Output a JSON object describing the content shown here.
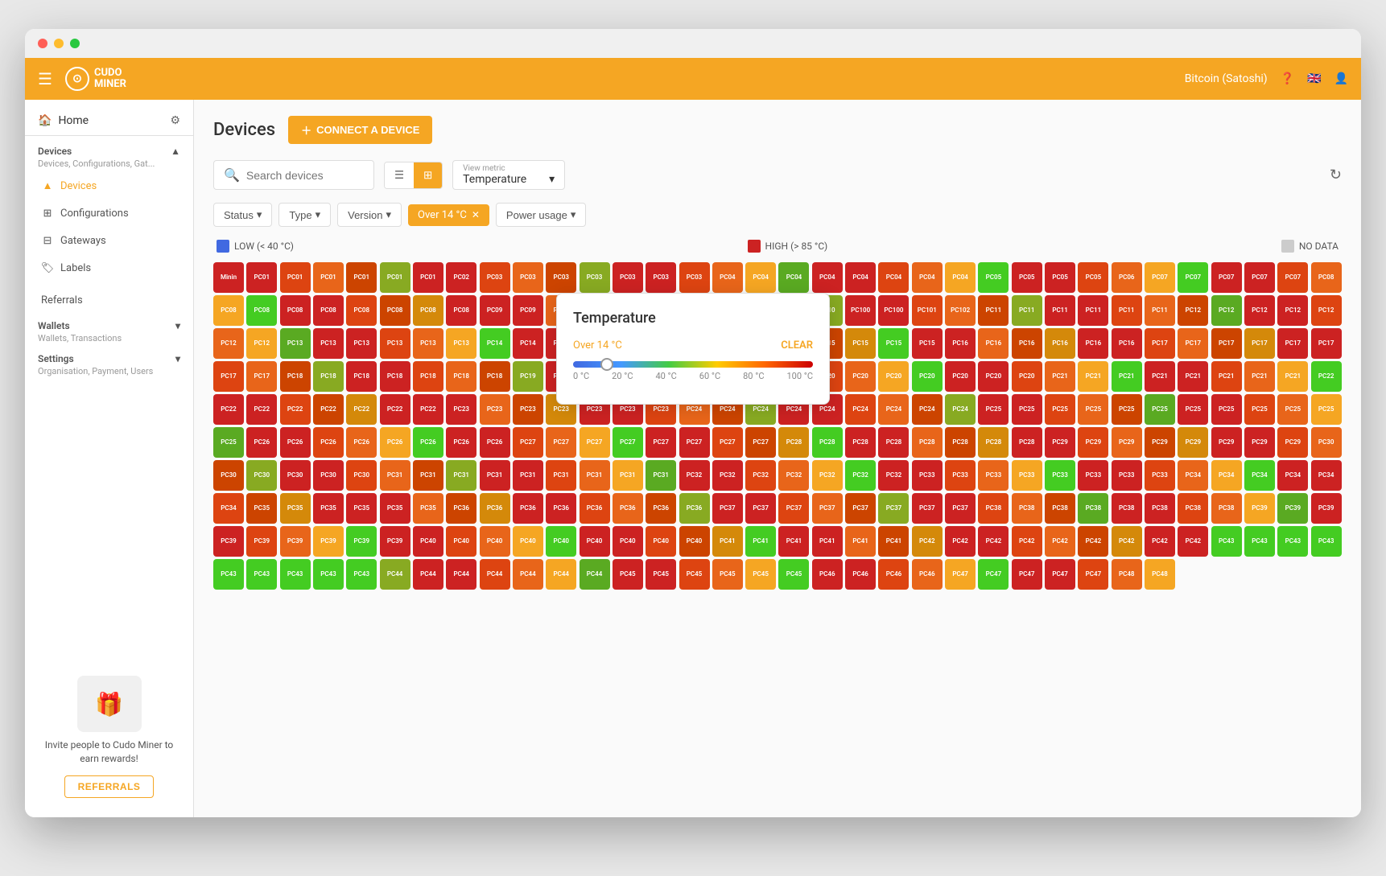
{
  "window": {
    "title": "Cudo Miner"
  },
  "navbar": {
    "logo_text": "CUDO\nMINER",
    "currency": "Bitcoin (Satoshi)",
    "help_icon": "?",
    "flag_icon": "🇬🇧",
    "user_icon": "👤"
  },
  "sidebar": {
    "home_label": "Home",
    "devices_section": {
      "title": "Devices",
      "subtitle": "Devices, Configurations, Gat...",
      "items": [
        {
          "label": "Devices",
          "active": true,
          "icon": "triangle"
        },
        {
          "label": "Configurations",
          "active": false,
          "icon": "grid"
        },
        {
          "label": "Gateways",
          "active": false,
          "icon": "server"
        },
        {
          "label": "Labels",
          "active": false,
          "icon": "tag"
        }
      ]
    },
    "referrals_label": "Referrals",
    "wallets_section": {
      "title": "Wallets",
      "subtitle": "Wallets, Transactions"
    },
    "settings_section": {
      "title": "Settings",
      "subtitle": "Organisation, Payment, Users"
    },
    "referral_cta_text": "Invite people to Cudo Miner to earn rewards!",
    "referral_btn_label": "REFERRALS"
  },
  "page": {
    "title": "Devices",
    "connect_btn": "CONNECT A DEVICE"
  },
  "toolbar": {
    "search_placeholder": "Search devices",
    "view_metric_label": "View metric",
    "view_metric_value": "Temperature"
  },
  "filters": {
    "status_label": "Status",
    "type_label": "Type",
    "version_label": "Version",
    "active_filter": "Over 14 °C",
    "power_label": "Power usage"
  },
  "legend": {
    "low_label": "LOW (< 40 °C)",
    "high_label": "HIGH (> 85 °C)",
    "no_data_label": "NO DATA",
    "low_color": "#4169e1",
    "high_color": "#cc2222",
    "no_data_color": "#cccccc"
  },
  "temperature_popup": {
    "title": "Temperature",
    "filter_label": "Over 14 °C",
    "clear_label": "CLEAR",
    "slider_min": "0 °C",
    "slider_marks": [
      "0 °C",
      "20 °C",
      "40 °C",
      "60 °C",
      "80 °C",
      "100 °C"
    ]
  },
  "devices": {
    "colors": [
      "c-red",
      "c-orange",
      "c-yellow",
      "c-dred",
      "c-dorange",
      "c-dyellow",
      "c-lime",
      "c-green",
      "c-bright-green",
      "c-gray"
    ],
    "rows": [
      [
        "Minin",
        "PC01",
        "PC01",
        "PC01",
        "PC01",
        "PC01",
        "PC01",
        "PC02",
        "PC03",
        "PC03",
        "PC03",
        "PC03",
        "PC03",
        "PC03",
        "PC03",
        "PC04",
        "PC04",
        "PC04",
        "PC04",
        "PC04",
        "PC04"
      ],
      [
        "PC04",
        "PC04",
        "PC05",
        "PC05",
        "PC05",
        "PC05",
        "PC06",
        "PC07",
        "PC07",
        "PC07",
        "PC07",
        "PC07",
        "PC08",
        "PC08",
        "PC08",
        "PC08",
        "PC08",
        "PC08",
        "PC08",
        "PC08"
      ],
      [
        "PC08",
        "PC09",
        "PC09",
        "PC09",
        "PC09",
        "PC09",
        "PC09",
        "PC10",
        "PC10",
        "PC10",
        "PC10",
        "PC10",
        "PC100",
        "PC100",
        "PC101",
        "PC102",
        "PC11",
        "PC11",
        "PC11",
        "PC11",
        "PC11",
        "PC11",
        "PC12"
      ],
      [
        "PC12",
        "PC12",
        "PC12",
        "PC12",
        "PC12",
        "PC12",
        "PC13",
        "PC13",
        "PC13",
        "PC13",
        "PC13",
        "PC13",
        "PC14",
        "PC14",
        "PC14",
        "PC14",
        "PC14",
        "PC14",
        "PC14",
        "PC15",
        "PC15",
        "PC15",
        "PC15",
        "PC15",
        "PC15",
        "PC15",
        "PC16"
      ],
      [
        "PC16",
        "PC16",
        "PC16",
        "PC16",
        "PC16",
        "PC17",
        "PC17",
        "PC17",
        "PC17",
        "PC17",
        "PC17",
        "PC17",
        "PC17",
        "PC18",
        "PC18",
        "PC18",
        "PC18",
        "PC18",
        "PC18",
        "PC18",
        "PC19",
        "PC19",
        "PC19",
        "PC19",
        "PC19",
        "PC19",
        "PC19"
      ],
      [
        "PC19",
        "PC19",
        "PC20",
        "PC20",
        "PC20",
        "PC20",
        "PC20",
        "PC20",
        "PC20",
        "PC21",
        "PC21",
        "PC21",
        "PC21",
        "PC21",
        "PC21",
        "PC21",
        "PC21",
        "PC22",
        "PC22",
        "PC22",
        "PC22",
        "PC22",
        "PC22",
        "PC22",
        "PC22",
        "PC23",
        "PC23"
      ],
      [
        "PC23",
        "PC23",
        "PC23",
        "PC23",
        "PC23",
        "PC24",
        "PC24",
        "PC24",
        "PC24",
        "PC24",
        "PC24",
        "PC24",
        "PC24",
        "PC24",
        "PC25",
        "PC25",
        "PC25",
        "PC25",
        "PC25",
        "PC25",
        "PC25",
        "PC25",
        "PC25",
        "PC25",
        "PC25",
        "PC25",
        "PC26",
        "PC26",
        "PC26",
        "PC26",
        "PC26"
      ],
      [
        "PC26",
        "PC26",
        "PC26",
        "PC27",
        "PC27",
        "PC27",
        "PC27",
        "PC27",
        "PC27",
        "PC27",
        "PC27",
        "PC28",
        "PC28",
        "PC28",
        "PC28",
        "PC28",
        "PC28",
        "PC28",
        "PC28",
        "PC29",
        "PC29",
        "PC29",
        "PC29",
        "PC29",
        "PC29",
        "PC29",
        "PC29",
        "PC30"
      ],
      [
        "PC30",
        "PC30",
        "PC30",
        "PC30",
        "PC30",
        "PC31",
        "PC31",
        "PC31",
        "PC31",
        "PC31",
        "PC31",
        "PC31",
        "PC31",
        "PC31",
        "PC32",
        "PC32",
        "PC32",
        "PC32",
        "PC32",
        "PC32",
        "PC32",
        "PC33",
        "PC33",
        "PC33",
        "PC33",
        "PC33",
        "PC33",
        "PC33",
        "PC33"
      ],
      [
        "PC34",
        "PC34",
        "PC34",
        "PC34",
        "PC34",
        "PC34",
        "PC35",
        "PC35",
        "PC35",
        "PC35",
        "PC35",
        "PC35",
        "PC36",
        "PC36",
        "PC36",
        "PC36",
        "PC36",
        "PC36",
        "PC36",
        "PC36",
        "PC37",
        "PC37",
        "PC37",
        "PC37",
        "PC37"
      ],
      [
        "PC37",
        "PC37",
        "PC37",
        "PC38",
        "PC38",
        "PC38",
        "PC38",
        "PC38",
        "PC38",
        "PC38",
        "PC38",
        "PC39",
        "PC39",
        "PC39",
        "PC39",
        "PC39",
        "PC39",
        "PC39",
        "PC39",
        "PC39",
        "PC40",
        "PC40",
        "PC40",
        "PC40",
        "PC40",
        "PC40",
        "PC40",
        "PC40",
        "PC40",
        "PC41"
      ],
      [
        "PC41",
        "PC41",
        "PC41",
        "PC41",
        "PC41",
        "PC42",
        "PC42",
        "PC42",
        "PC42",
        "PC42",
        "PC42",
        "PC42",
        "PC42",
        "PC42",
        "PC43",
        "PC43",
        "PC43",
        "PC43",
        "PC43",
        "PC43",
        "PC43",
        "PC43",
        "PC43",
        "PC44",
        "PC44",
        "PC44",
        "PC44",
        "PC44",
        "PC44",
        "PC44"
      ],
      [
        "PC45",
        "PC45",
        "PC45",
        "PC45",
        "PC45",
        "PC45",
        "PC46",
        "PC46",
        "PC46",
        "PC46",
        "PC47",
        "PC47",
        "PC47",
        "PC47",
        "PC47",
        "PC48",
        "PC48"
      ]
    ]
  }
}
